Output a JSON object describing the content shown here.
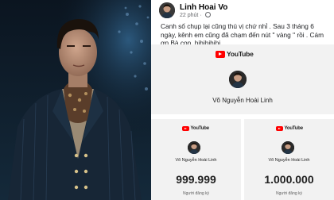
{
  "post": {
    "author": "Linh Hoai Vo",
    "time": "22 phút",
    "text": "Canh số chụp lại cũng thú vị chứ nhỉ . Sau 3 tháng 6 ngày, kênh em cũng đã chạm đến nút \" vàng \" rồi . Cám ơn Bà con .hihihihihi"
  },
  "screenshots": {
    "logo_text": "YouTube",
    "channel_name": "Võ Nguyễn Hoài Linh",
    "left_count": "999.999",
    "right_count": "1.000.000",
    "subs_label": "Người đăng ký"
  }
}
